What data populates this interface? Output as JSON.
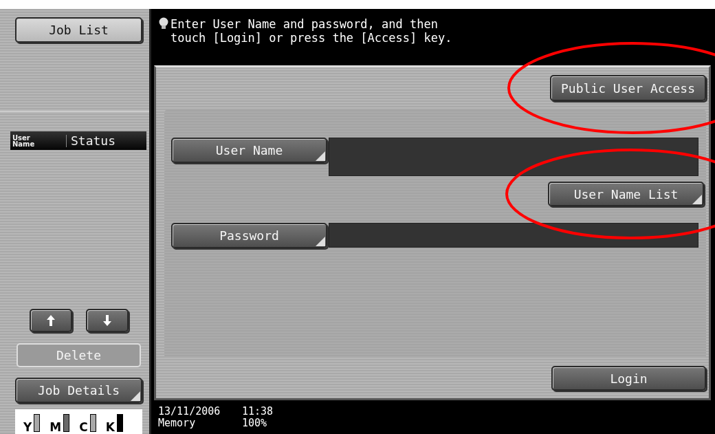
{
  "sidebar": {
    "job_list_button": {
      "label": "Job List"
    },
    "table": {
      "columns": [
        "User\nName",
        "Status"
      ]
    },
    "scroll_buttons": [
      {
        "kind": "up"
      },
      {
        "kind": "down"
      }
    ],
    "delete_button": {
      "label": "Delete",
      "disabled": true
    },
    "job_details_button": {
      "label": "Job Details",
      "corner": true
    },
    "toner": [
      {
        "label": "Y",
        "color": "#a8a8a8"
      },
      {
        "label": "M",
        "color": "#6a6a6a"
      },
      {
        "label": "C",
        "color": "#a8a8a8"
      },
      {
        "label": "K",
        "color": "#000000"
      }
    ]
  },
  "message": {
    "lines": [
      "Enter User Name and password, and then",
      "touch [Login] or press the [Access] key."
    ]
  },
  "public_access_button": {
    "label": "Public User Access",
    "corner": false,
    "circled": true
  },
  "fields": [
    {
      "label": "User Name",
      "corner": true,
      "tall": true
    },
    {
      "label": "Password",
      "corner": true,
      "tall": false
    }
  ],
  "user_list_button": {
    "label": "User Name List",
    "corner": true,
    "circled": true
  },
  "login_button": {
    "label": "Login",
    "corner": false,
    "circled": false
  },
  "status_bar": {
    "date": "13/11/2006",
    "time": "11:38",
    "memory_label": "Memory",
    "memory_value": "100%"
  }
}
